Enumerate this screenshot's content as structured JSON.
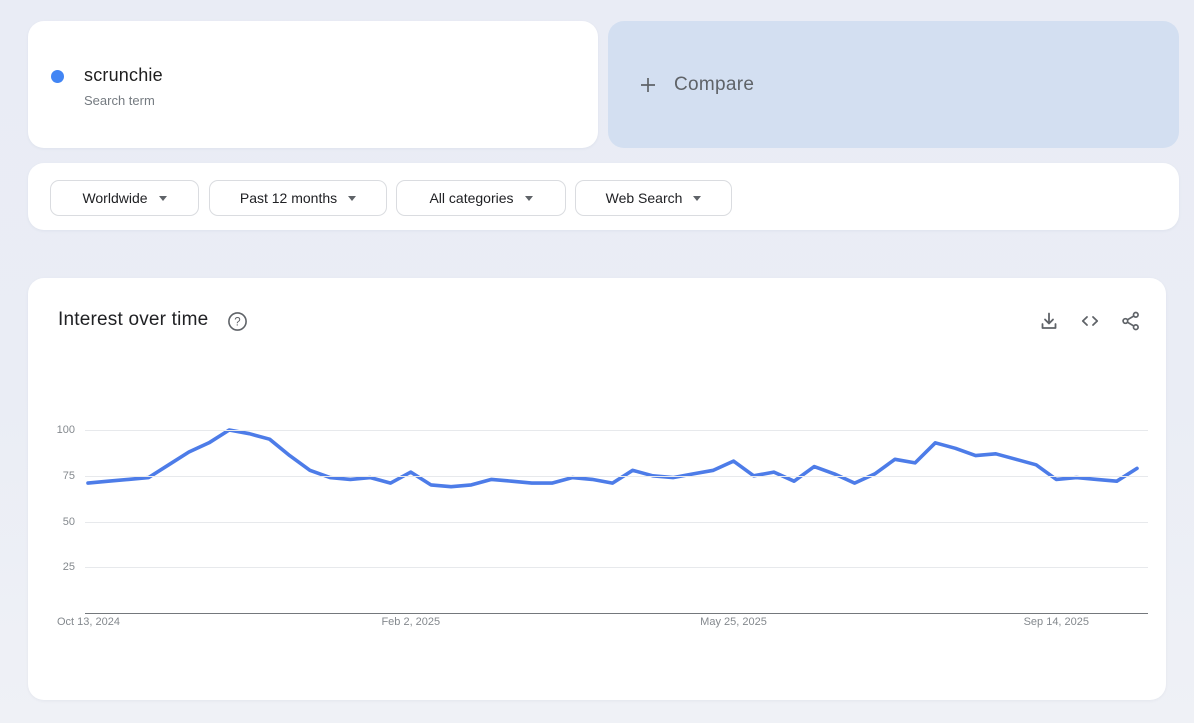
{
  "term_card": {
    "term": "scrunchie",
    "subtitle": "Search term",
    "dot_color": "#4285f4"
  },
  "compare_card": {
    "label": "Compare"
  },
  "filters": [
    {
      "id": "region",
      "label": "Worldwide"
    },
    {
      "id": "time",
      "label": "Past 12 months"
    },
    {
      "id": "category",
      "label": "All categories"
    },
    {
      "id": "search-type",
      "label": "Web Search"
    }
  ],
  "chart_card": {
    "title": "Interest over time",
    "help_glyph": "?"
  },
  "chart_data": {
    "type": "line",
    "title": "Interest over time",
    "series": [
      {
        "name": "scrunchie",
        "color": "#4d7ce8",
        "values": [
          71,
          72,
          73,
          74,
          81,
          88,
          93,
          100,
          98,
          95,
          86,
          78,
          74,
          73,
          74,
          71,
          77,
          70,
          69,
          70,
          73,
          72,
          71,
          71,
          74,
          73,
          71,
          78,
          75,
          74,
          76,
          78,
          83,
          75,
          77,
          72,
          80,
          76,
          71,
          76,
          84,
          82,
          93,
          90,
          86,
          87,
          84,
          81,
          73,
          74,
          73,
          72,
          79
        ]
      }
    ],
    "x": {
      "tick_labels": [
        "Oct 13, 2024",
        "Feb 2, 2025",
        "May 25, 2025",
        "Sep 14, 2025"
      ],
      "tick_week_indices": [
        0,
        16,
        32,
        48
      ]
    },
    "y": {
      "ticks": [
        25,
        50,
        75,
        100
      ],
      "lim": [
        0,
        100
      ]
    },
    "grid": true,
    "legend_position": "none"
  }
}
